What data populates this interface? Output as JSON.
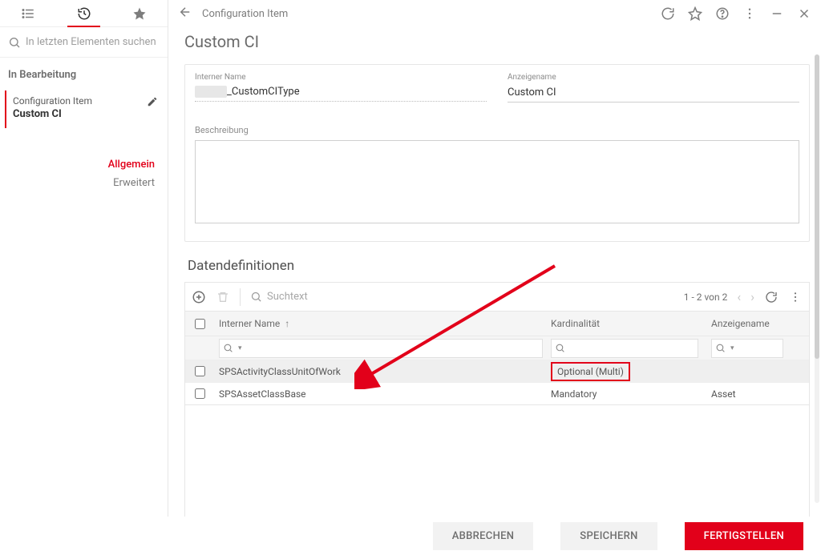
{
  "sidebar": {
    "search_placeholder": "In letzten Elementen suchen",
    "heading": "In Bearbeitung",
    "item": {
      "title": "Configuration Item",
      "subtitle": "Custom CI"
    },
    "sections": {
      "general": "Allgemein",
      "advanced": "Erweitert"
    }
  },
  "header": {
    "breadcrumb": "Configuration Item",
    "page_title": "Custom CI"
  },
  "form": {
    "internal_name_label": "Interner Name",
    "internal_name_value": "_CustomCIType",
    "display_name_label": "Anzeigename",
    "display_name_value": "Custom CI",
    "description_label": "Beschreibung",
    "description_value": ""
  },
  "grid": {
    "title": "Datendefinitionen",
    "search_placeholder": "Suchtext",
    "pager": "1 - 2 von 2",
    "columns": {
      "c1": "Interner Name",
      "c2": "Kardinalität",
      "c3": "Anzeigename"
    },
    "rows": [
      {
        "name": "SPSActivityClassUnitOfWork",
        "card": "Optional (Multi)",
        "disp": ""
      },
      {
        "name": "SPSAssetClassBase",
        "card": "Mandatory",
        "disp": "Asset"
      }
    ]
  },
  "footer": {
    "cancel": "ABBRECHEN",
    "save": "SPEICHERN",
    "finish": "FERTIGSTELLEN"
  }
}
